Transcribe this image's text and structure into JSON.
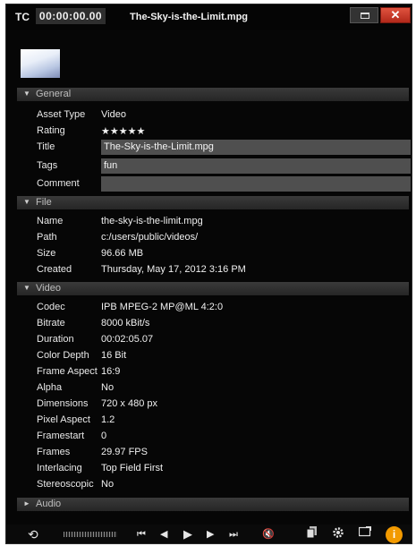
{
  "titlebar": {
    "tc_label": "TC",
    "timecode": "00:00:00.00",
    "filename": "The-Sky-is-the-Limit.mpg"
  },
  "sections": {
    "general": "General",
    "file": "File",
    "video": "Video",
    "audio": "Audio"
  },
  "general": {
    "asset_type": {
      "label": "Asset Type",
      "value": "Video"
    },
    "rating": {
      "label": "Rating",
      "value": "★★★★★",
      "stars": 5
    },
    "title": {
      "label": "Title",
      "value": "The-Sky-is-the-Limit.mpg"
    },
    "tags": {
      "label": "Tags",
      "value": "fun"
    },
    "comment": {
      "label": "Comment",
      "value": ""
    }
  },
  "file": {
    "name": {
      "label": "Name",
      "value": "the-sky-is-the-limit.mpg"
    },
    "path": {
      "label": "Path",
      "value": "c:/users/public/videos/"
    },
    "size": {
      "label": "Size",
      "value": "96.66 MB"
    },
    "created": {
      "label": "Created",
      "value": "Thursday, May 17, 2012 3:16 PM"
    }
  },
  "video": {
    "codec": {
      "label": "Codec",
      "value": "IPB MPEG-2  MP@ML 4:2:0"
    },
    "bitrate": {
      "label": "Bitrate",
      "value": "8000 kBit/s"
    },
    "duration": {
      "label": "Duration",
      "value": "00:02:05.07"
    },
    "color_depth": {
      "label": "Color Depth",
      "value": "16 Bit"
    },
    "frame_aspect": {
      "label": "Frame Aspect",
      "value": "16:9"
    },
    "alpha": {
      "label": "Alpha",
      "value": "No"
    },
    "dimensions": {
      "label": "Dimensions",
      "value": "720 x 480 px"
    },
    "pixel_aspect": {
      "label": "Pixel Aspect",
      "value": "1.2"
    },
    "framestart": {
      "label": "Framestart",
      "value": "0"
    },
    "frames": {
      "label": "Frames",
      "value": "29.97 FPS"
    },
    "interlacing": {
      "label": "Interlacing",
      "value": "Top Field First"
    },
    "stereoscopic": {
      "label": "Stereoscopic",
      "value": "No"
    }
  },
  "colors": {
    "background": "#060606",
    "section_bar": "#2e2e2e",
    "field": "#4f4f4f",
    "close_button": "#c93b28",
    "info_button": "#f29a00"
  },
  "icons": {
    "section_expanded": "▼",
    "section_collapsed": "►",
    "close": "✕",
    "loop": "⟲",
    "go_to_start": "⏮",
    "step_back": "◀",
    "play": "▶",
    "step_forward": "▶",
    "go_to_end": "⏭",
    "volume": "🔇",
    "info": "i"
  }
}
